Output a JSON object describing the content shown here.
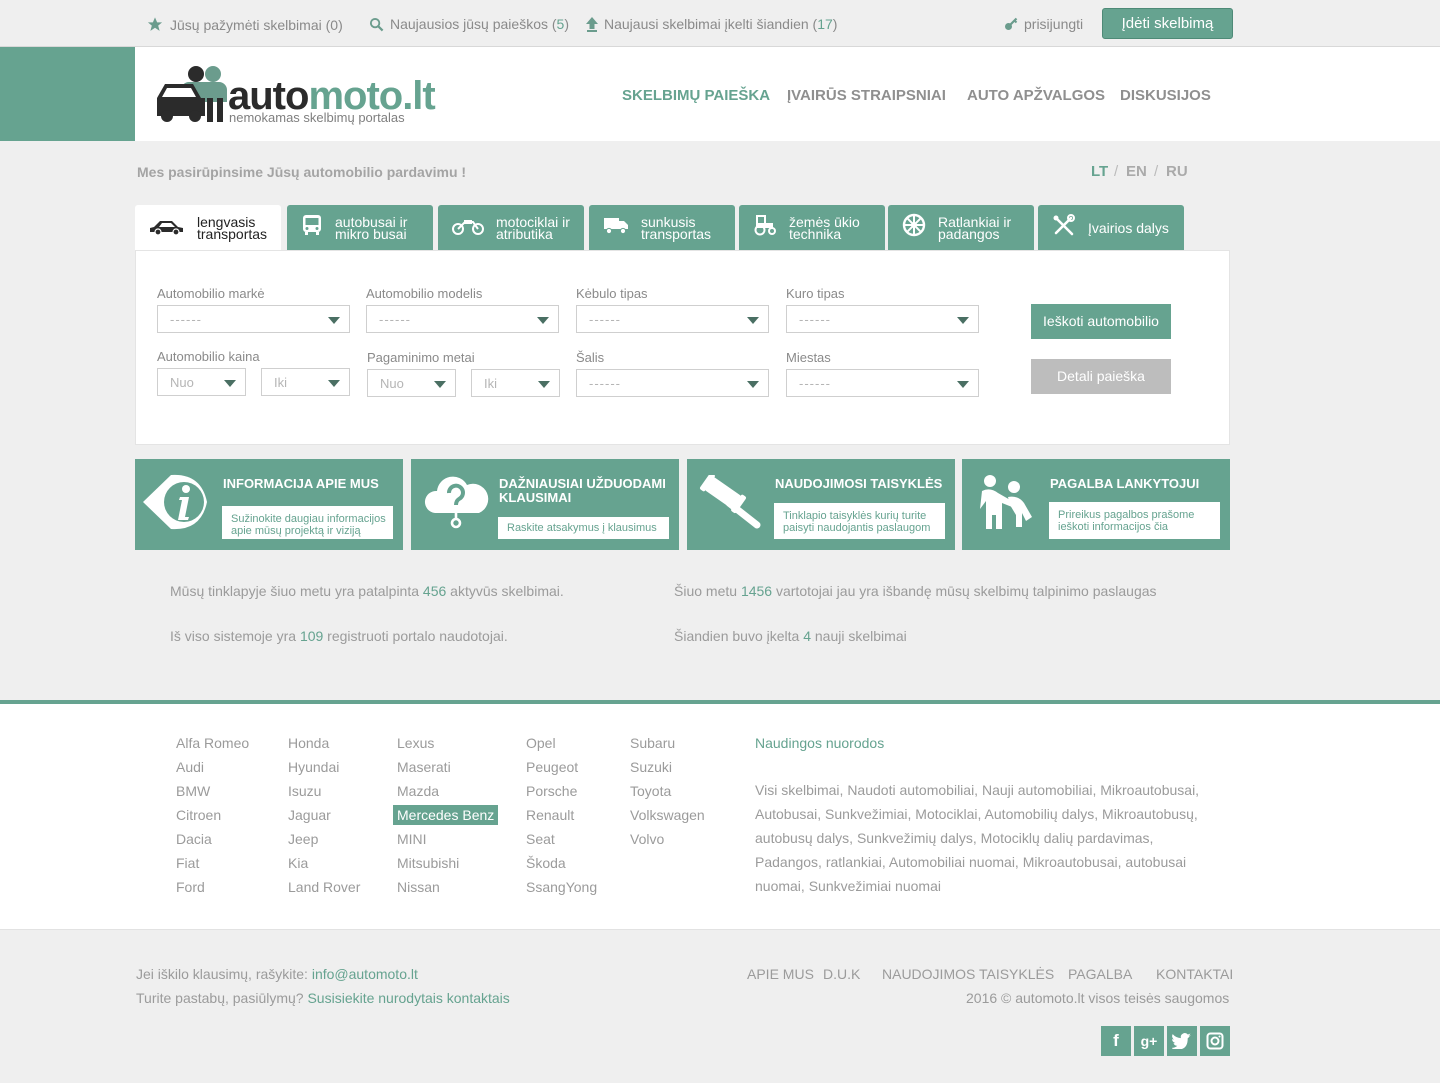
{
  "topbar": {
    "saved": {
      "label": "Jūsų pažymėti skelbimai (",
      "count": "0",
      "close": ")"
    },
    "searches": {
      "label": "Naujausios jūsų paieškos (",
      "count": "5",
      "close": ")"
    },
    "newest": {
      "label": "Naujausi skelbimai įkelti šiandien (",
      "count": "17",
      "close": ")"
    },
    "login": "prisijungti",
    "post_button": "Įdėti skelbimą"
  },
  "logo": {
    "part1": "auto",
    "part2": "moto.lt",
    "tagline": "nemokamas skelbimų portalas"
  },
  "nav": [
    "SKELBIMŲ PAIEŠKA",
    "ĮVAIRŪS STRAIPSNIAI",
    "AUTO APŽVALGOS",
    "DISKUSIJOS"
  ],
  "intro": "Mes pasirūpinsime Jūsų automobilio pardavimu !",
  "languages": [
    "LT",
    "EN",
    "RU"
  ],
  "tabs": [
    {
      "label": "lengvasis transportas",
      "icon": "car-icon"
    },
    {
      "label": "autobusai ir mikro busai",
      "icon": "bus-icon"
    },
    {
      "label": "motociklai ir atributika",
      "icon": "motorcycle-icon"
    },
    {
      "label": "sunkusis transportas",
      "icon": "truck-icon"
    },
    {
      "label": "žemės ūkio technika",
      "icon": "tractor-icon"
    },
    {
      "label": "Ratlankiai ir padangos",
      "icon": "wheel-icon"
    },
    {
      "label": "Įvairios dalys",
      "icon": "tools-icon"
    }
  ],
  "search": {
    "make_label": "Automobilio markė",
    "model_label": "Automobilio modelis",
    "body_label": "Kėbulo tipas",
    "fuel_label": "Kuro tipas",
    "price_label": "Automobilio kaina",
    "year_label": "Pagaminimo metai",
    "country_label": "Šalis",
    "city_label": "Miestas",
    "placeholder": "------",
    "from": "Nuo",
    "to": "Iki",
    "search_button": "Ieškoti automobilio",
    "detail_button": "Detali paieška"
  },
  "info_boxes": [
    {
      "title": "INFORMACIJA APIE MUS",
      "desc": "Sužinokite daugiau informacijos apie mūsų projektą ir viziją",
      "icon": "info-icon"
    },
    {
      "title": "DAŽNIAUSIAI UŽDUODAMI KLAUSIMAI",
      "desc": "Raskite atsakymus į  klausimus",
      "icon": "question-cloud-icon"
    },
    {
      "title": "NAUDOJIMOSI TAISYKLĖS",
      "desc": "Tinklapio taisyklės kurių turite paisyti naudojantis paslaugom",
      "icon": "gavel-icon"
    },
    {
      "title": "PAGALBA LANKYTOJUI",
      "desc": "Prireikus pagalbos prašome ieškoti informacijos čia",
      "icon": "helping-people-icon"
    }
  ],
  "stats": {
    "s1": {
      "pre": "Mūsų tinklapyje šiuo metu yra patalpinta ",
      "n": "456",
      "post": " aktyvūs skelbimai."
    },
    "s2": {
      "pre": "Šiuo metu ",
      "n": "1456",
      "post": " vartotojai jau yra išbandę mūsų skelbimų talpinimo paslaugas"
    },
    "s3": {
      "pre": "Iš viso sistemoje yra ",
      "n": "109",
      "post": " registruoti portalo naudotojai."
    },
    "s4": {
      "pre": "Šiandien buvo įkelta ",
      "n": "4",
      "post": " nauji skelbimai"
    }
  },
  "brands": [
    [
      "Alfa Romeo",
      "Audi",
      "BMW",
      "Citroen",
      "Dacia",
      "Fiat",
      "Ford"
    ],
    [
      "Honda",
      "Hyundai",
      "Isuzu",
      "Jaguar",
      "Jeep",
      "Kia",
      "Land Rover"
    ],
    [
      "Lexus",
      "Maserati",
      "Mazda",
      "Mercedes Benz",
      "MINI",
      "Mitsubishi",
      "Nissan"
    ],
    [
      "Opel",
      "Peugeot",
      "Porsche",
      "Renault",
      "Seat",
      "Škoda",
      "SsangYong"
    ],
    [
      "Subaru",
      "Suzuki",
      "Toyota",
      "Volkswagen",
      "Volvo"
    ]
  ],
  "useful": {
    "title": "Naudingos nuorodos",
    "text": "Visi skelbimai, Naudoti automobiliai, Nauji automobiliai, Mikroautobusai, Autobusai, Sunkvežimiai, Motociklai, Automobilių dalys, Mikroautobusų, autobusų dalys, Sunkvežimių dalys, Motociklų dalių pardavimas, Padangos, ratlankiai, Automobiliai nuomai, Mikroautobusai, autobusai nuomai, Sunkvežimiai nuomai"
  },
  "footer": {
    "q1": "Jei iškilo klausimų, rašykite: ",
    "email": "info@automoto.lt",
    "q2": "Turite pastabų, pasiūlymų? ",
    "contact": "Susisiekite nurodytais kontaktais",
    "nav": [
      "APIE MUS",
      "D.U.K",
      "NAUDOJIMOS TAISYKLĖS",
      "PAGALBA",
      "KONTAKTAI"
    ],
    "copyright": "2016 © automoto.lt visos teisės saugomos",
    "social": [
      {
        "icon": "facebook-icon",
        "glyph": "f"
      },
      {
        "icon": "google-plus-icon",
        "glyph": "g+"
      },
      {
        "icon": "twitter-icon",
        "glyph": "t"
      },
      {
        "icon": "instagram-icon",
        "glyph": "◘"
      }
    ]
  },
  "colors": {
    "accent": "#66a390",
    "background": "#efefef",
    "text": "#9b9b9b"
  }
}
